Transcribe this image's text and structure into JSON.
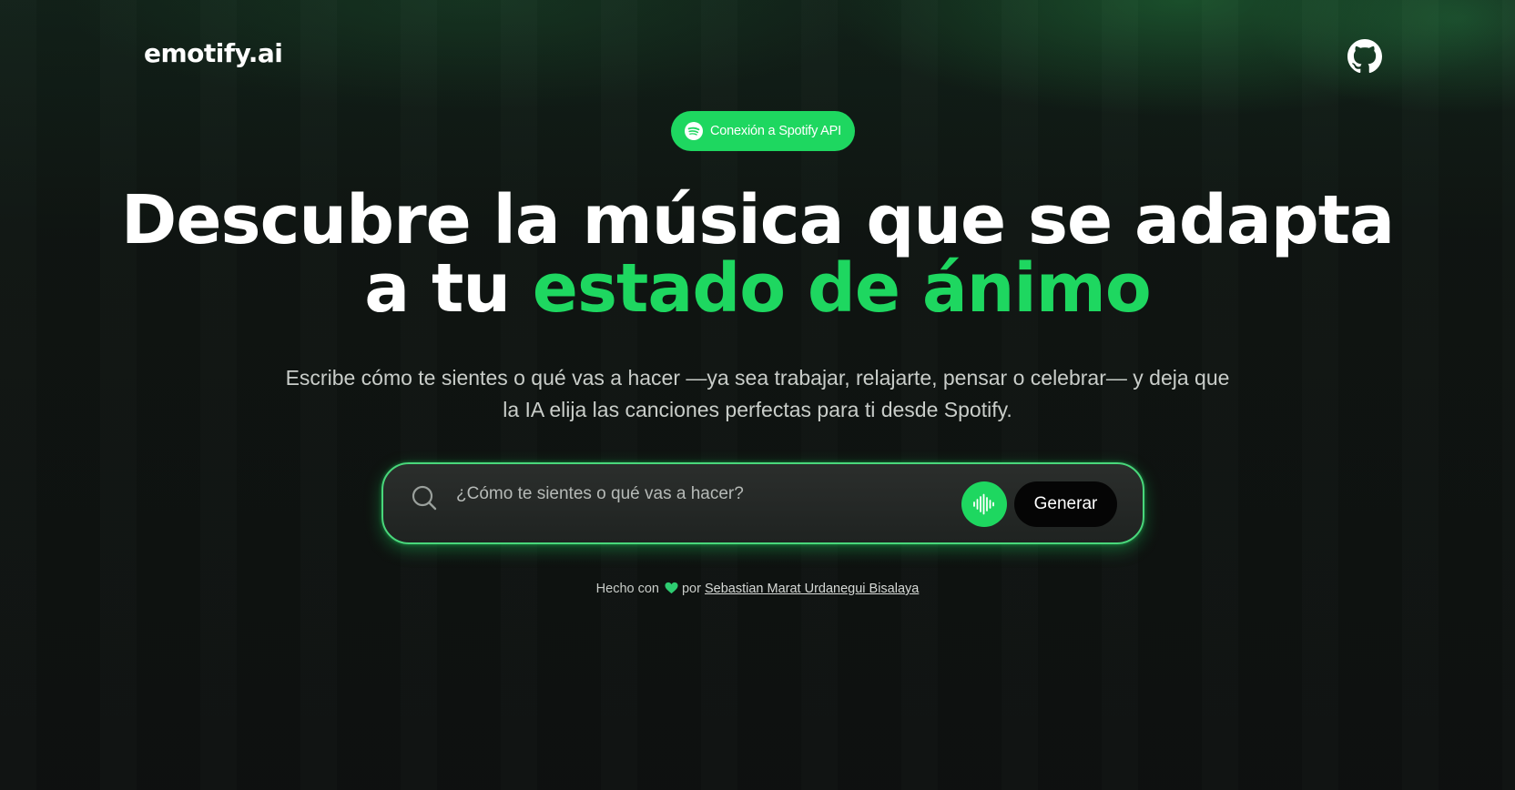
{
  "header": {
    "logo": "emotify.ai",
    "github_icon": "github-icon"
  },
  "badge": {
    "label": "Conexión a Spotify API",
    "icon": "spotify-icon"
  },
  "hero": {
    "title_line1": "Descubre la música que se adapta",
    "title_line2_prefix": "a tu ",
    "title_line2_highlight": "estado de ánimo",
    "subtitle_line1": "Escribe cómo te sientes o qué vas a hacer —ya sea trabajar, relajarte, pensar o celebrar— y deja que",
    "subtitle_line2": "la IA elija las canciones perfectas para ti desde Spotify."
  },
  "search": {
    "placeholder": "¿Cómo te sientes o qué vas a hacer?",
    "value": "",
    "search_icon": "search-icon",
    "voice_icon": "sound-wave-icon",
    "generate_label": "Generar"
  },
  "footer": {
    "made_with": "Hecho con",
    "heart_icon": "green-heart-icon",
    "by": "por",
    "author": "Sebastian Marat Urdanegui Bisalaya"
  },
  "colors": {
    "accent": "#1ed760",
    "background": "#0f1311",
    "button_dark": "#050505"
  }
}
